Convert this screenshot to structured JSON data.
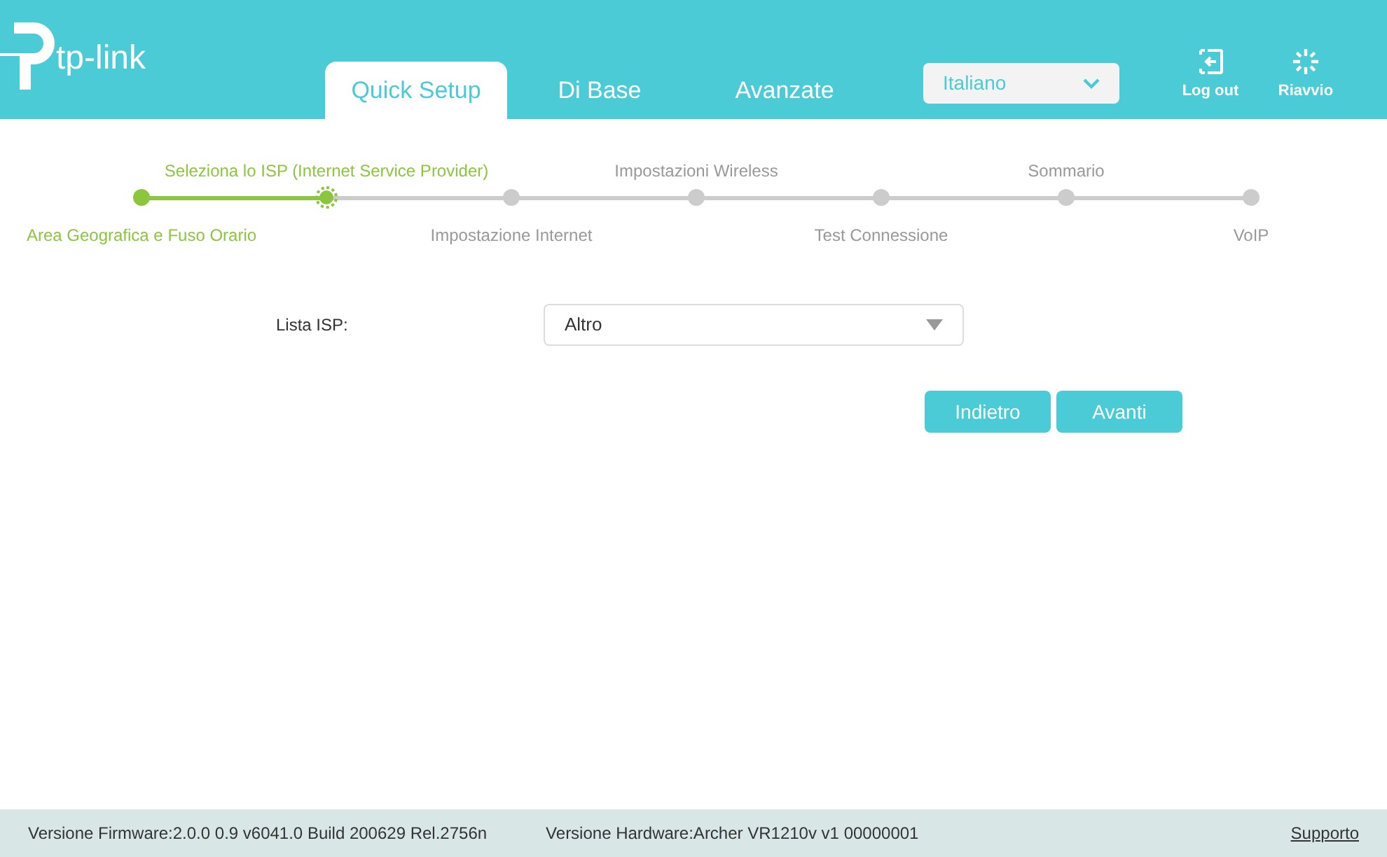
{
  "logo": {
    "text": "tp-link"
  },
  "tabs": [
    {
      "label": "Quick Setup",
      "selected": true
    },
    {
      "label": "Di Base",
      "selected": false
    },
    {
      "label": "Avanzate",
      "selected": false
    }
  ],
  "language": {
    "value": "Italiano"
  },
  "actions": [
    {
      "kind": "logout",
      "label": "Log out"
    },
    {
      "kind": "reboot",
      "label": "Riavvio"
    }
  ],
  "steps": [
    {
      "label": "Area Geografica e Fuso Orario",
      "done": true,
      "selected": false
    },
    {
      "label": "Seleziona lo ISP (Internet Service Provider)",
      "done": false,
      "selected": true
    },
    {
      "label": "Impostazione Internet",
      "done": false,
      "selected": false
    },
    {
      "label": "Impostazioni Wireless",
      "done": false,
      "selected": false
    },
    {
      "label": "Test Connessione",
      "done": false,
      "selected": false
    },
    {
      "label": "Sommario",
      "done": false,
      "selected": false
    },
    {
      "label": "VoIP",
      "done": false,
      "selected": false
    }
  ],
  "form": {
    "label": "Lista ISP:",
    "value": "Altro"
  },
  "buttons": [
    "Indietro",
    "Avanti"
  ],
  "footer": {
    "firmware": "Versione Firmware:2.0.0 0.9 v6041.0 Build 200629 Rel.2756n",
    "hardware": "Versione Hardware:Archer VR1210v v1 00000001",
    "link": "Supporto"
  }
}
